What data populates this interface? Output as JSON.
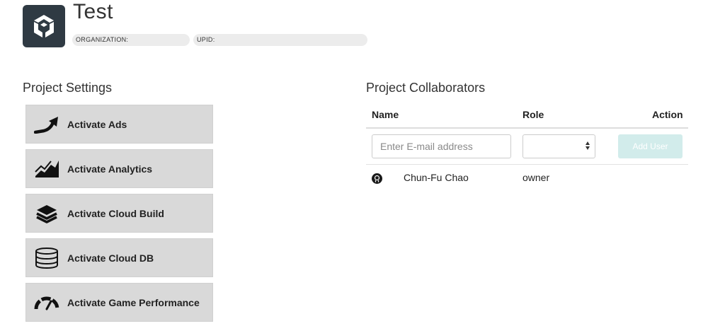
{
  "header": {
    "logo_icon": "unity-logo-icon",
    "project_title": "Test",
    "organization_label": "ORGANIZATION:",
    "upid_label": "UPID:"
  },
  "project_settings": {
    "title": "Project Settings",
    "items": [
      {
        "label": "Activate Ads",
        "icon": "ads-arrow-icon"
      },
      {
        "label": "Activate Analytics",
        "icon": "analytics-chart-icon"
      },
      {
        "label": "Activate Cloud Build",
        "icon": "cloud-build-stack-icon"
      },
      {
        "label": "Activate Cloud DB",
        "icon": "database-icon"
      },
      {
        "label": "Activate Game Performance",
        "icon": "speedometer-icon"
      }
    ]
  },
  "collaborators": {
    "title": "Project Collaborators",
    "columns": {
      "name": "Name",
      "role": "Role",
      "action": "Action"
    },
    "email_placeholder": "Enter E-mail address",
    "role_value": "",
    "add_user_label": "Add User",
    "rows": [
      {
        "name": "Chun-Fu Chao",
        "role": "owner",
        "avatar_icon": "user-avatar-icon"
      }
    ]
  },
  "colors": {
    "logo_bg": "#2f3a43",
    "button_bg": "#d9d9d9",
    "add_user_bg": "#d2eceb"
  }
}
